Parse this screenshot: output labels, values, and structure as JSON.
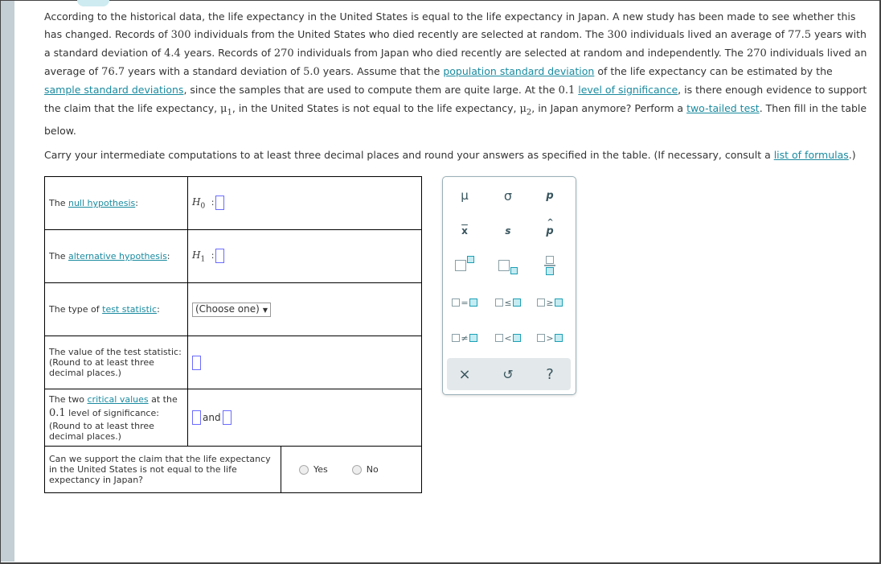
{
  "problem": {
    "p1_a": "According to the historical data, the life expectancy in the United States is equal to the life expectancy in Japan. A new study has been made to see whether this has changed. Records of ",
    "n1": "300",
    "p1_b": " individuals from the United States who died recently are selected at random. The ",
    "n1b": "300",
    "p1_c": " individuals lived an average of ",
    "mean1": "77.5",
    "p1_d": " years with a standard deviation of ",
    "sd1": "4.4",
    "p1_e": " years. Records of ",
    "n2": "270",
    "p1_f": " individuals from Japan who died recently are selected at random and independently. The ",
    "n2b": "270",
    "p1_g": " individuals lived an average of ",
    "mean2": "76.7",
    "p1_h": " years with a standard deviation of ",
    "sd2": "5.0",
    "p1_i": " years. Assume that the ",
    "link_pop_sd": "population standard deviation",
    "p1_j": " of the life expectancy can be estimated by the ",
    "link_sample_sd": "sample standard deviations",
    "p1_k": ", since the samples that are used to compute them are quite large. At the ",
    "alpha": "0.1",
    "p1_l": " ",
    "link_los": "level of significance",
    "p1_m": ", is there enough evidence to support the claim that the life expectancy, ",
    "mu": "μ",
    "sub1": "1",
    "p1_n": ", in the United States is not equal to the life expectancy, ",
    "sub2": "2",
    "p1_o": ", in Japan anymore? Perform a ",
    "link_two_tailed": "two-tailed test",
    "p1_p": ". Then fill in the table below.",
    "p2_a": "Carry your intermediate computations to at least three decimal places and round your answers as specified in the table. (If necessary, consult a ",
    "link_formulas": "list of formulas",
    "p2_b": ".)"
  },
  "table": {
    "null_pre": "The ",
    "null_link": "null hypothesis",
    "null_post": ":",
    "h0": "H",
    "h0_sub": "0",
    "alt_pre": "The ",
    "alt_link": "alternative hypothesis",
    "alt_post": ":",
    "h1": "H",
    "h1_sub": "1",
    "colon": ":",
    "type_pre": "The type of ",
    "type_link": "test statistic",
    "type_post": ":",
    "select_value": "(Choose one)",
    "value_label_1": "The value of the test statistic:",
    "value_label_2": "(Round to at least three decimal places.)",
    "crit_pre": "The two ",
    "crit_link": "critical values",
    "crit_post": " at the",
    "crit_alpha": "0.1",
    "crit_los": " level of significance:",
    "crit_round": "(Round to at least three decimal places.)",
    "and_label": "and",
    "question": "Can we support the claim that the life expectancy in the United States is not equal to the life expectancy in Japan?",
    "yes": "Yes",
    "no": "No"
  },
  "palette": {
    "mu": "μ",
    "sigma": "σ",
    "p": "p",
    "xbar": "x",
    "s": "s",
    "phat": "p",
    "hat": "^",
    "eq": "=",
    "le": "≤",
    "ge": "≥",
    "ne": "≠",
    "lt": "<",
    "gt": ">",
    "clear": "×",
    "undo": "↺",
    "help": "?"
  }
}
